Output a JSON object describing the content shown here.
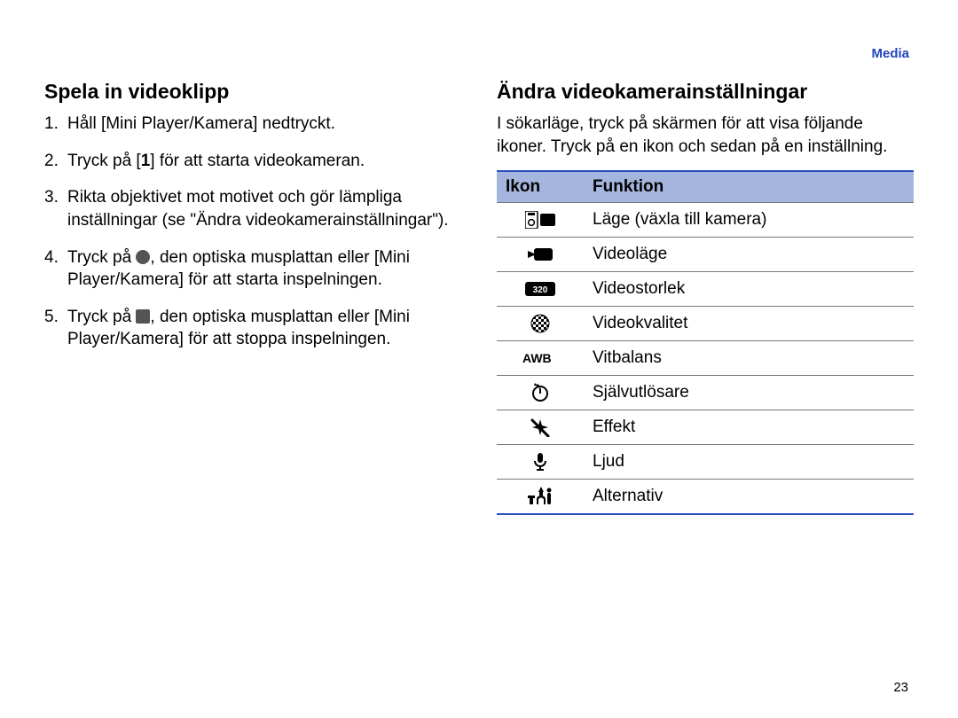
{
  "header": {
    "breadcrumb": "Media"
  },
  "left": {
    "heading": "Spela in videoklipp",
    "steps": {
      "s1": "Håll [Mini Player/Kamera] nedtryckt.",
      "s2_a": "Tryck på [",
      "s2_key": "1",
      "s2_b": "] för att starta videokameran.",
      "s3": "Rikta objektivet mot motivet och gör lämpliga inställningar (se \"Ändra videokamerainställningar\").",
      "s4_a": "Tryck på ",
      "s4_b": ", den optiska musplattan eller [Mini Player/Kamera] för att starta inspelningen.",
      "s5_a": "Tryck på ",
      "s5_b": ", den optiska musplattan eller [Mini Player/Kamera] för att stoppa inspelningen."
    }
  },
  "right": {
    "heading": "Ändra videokamerainställningar",
    "intro": "I sökarläge, tryck på skärmen för att visa följande ikoner. Tryck på en ikon och sedan på en inställning.",
    "table": {
      "col_icon": "Ikon",
      "col_func": "Funktion",
      "rows": [
        {
          "func": "Läge (växla till kamera)"
        },
        {
          "func": "Videoläge"
        },
        {
          "func": "Videostorlek"
        },
        {
          "func": "Videokvalitet"
        },
        {
          "func": "Vitbalans"
        },
        {
          "func": "Självutlösare"
        },
        {
          "func": "Effekt"
        },
        {
          "func": "Ljud"
        },
        {
          "func": "Alternativ"
        }
      ]
    }
  },
  "page_number": "23"
}
